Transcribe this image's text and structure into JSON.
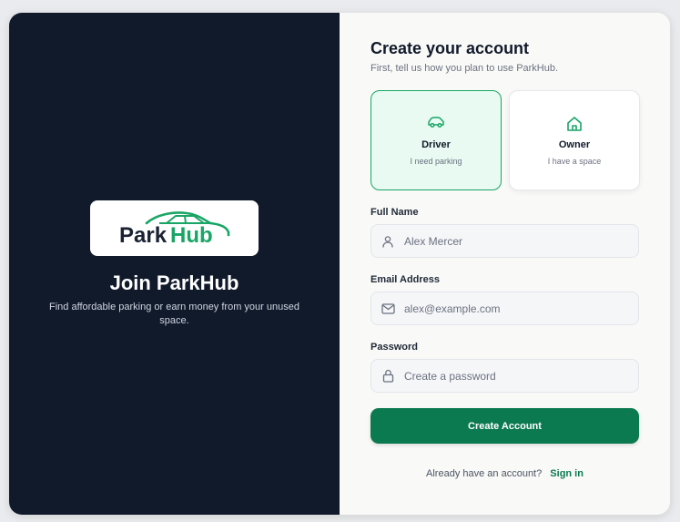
{
  "brand": {
    "logo_text_park": "Park",
    "logo_text_hub": "Hub",
    "accent": "#19a566",
    "dark": "#111a2b"
  },
  "left": {
    "title": "Join ParkHub",
    "subtitle": "Find affordable parking or earn money from your unused space."
  },
  "form": {
    "title": "Create your account",
    "subtitle": "First, tell us how you plan to use ParkHub.",
    "roles": [
      {
        "label": "Driver",
        "sub": "I need parking",
        "icon": "car-icon",
        "selected": true
      },
      {
        "label": "Owner",
        "sub": "I have a space",
        "icon": "home-icon",
        "selected": false
      }
    ],
    "fields": {
      "name": {
        "label": "Full Name",
        "placeholder": "Alex Mercer",
        "icon": "user-icon"
      },
      "email": {
        "label": "Email Address",
        "placeholder": "alex@example.com",
        "icon": "mail-icon"
      },
      "password": {
        "label": "Password",
        "placeholder": "Create a password",
        "icon": "lock-icon"
      }
    },
    "submit_label": "Create Account",
    "footer_text": "Already have an account?",
    "signin_label": "Sign in"
  }
}
